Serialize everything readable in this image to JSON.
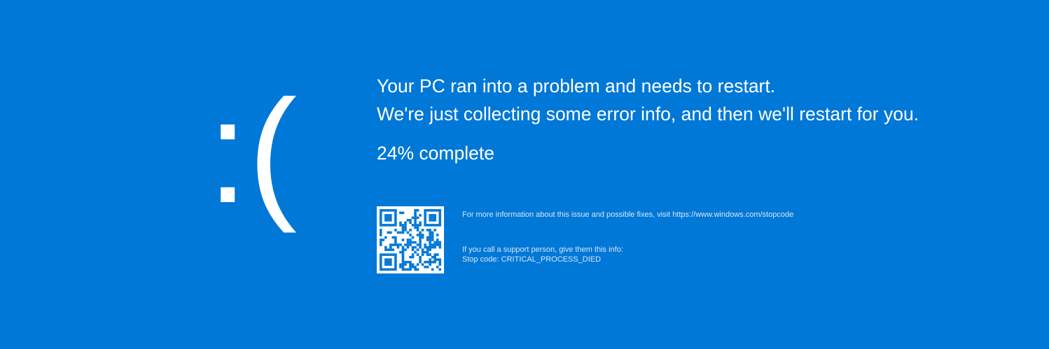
{
  "screen": {
    "background_color": "#0078d7",
    "text_color": "#ffffff"
  },
  "emoticon": ":(",
  "message": {
    "line1": "Your PC ran into a problem and needs to restart.",
    "line2": "We're just collecting some error info, and then we'll restart for you."
  },
  "progress": {
    "percent": 24,
    "text": "24% complete"
  },
  "qr_code": {
    "icon": "qr-code-icon"
  },
  "info": {
    "more_info": "For more information about this issue and possible fixes, visit https://www.windows.com/stopcode",
    "support_line": "If you call a support person, give them this info:",
    "stop_code": "Stop code: CRITICAL_PROCESS_DIED"
  }
}
